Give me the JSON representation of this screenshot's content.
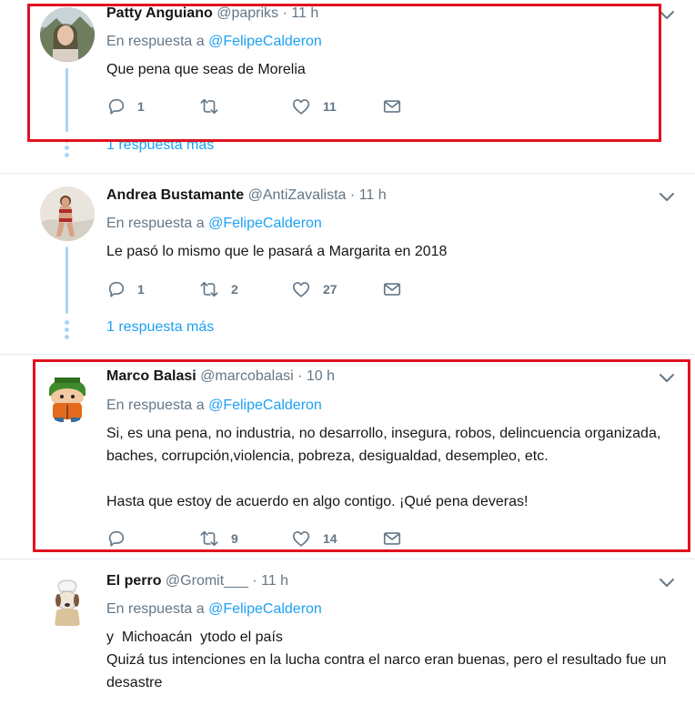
{
  "tweets": [
    {
      "name": "Patty Anguiano",
      "handle": "@papriks",
      "sep": "·",
      "time": "11 h",
      "reply_prefix": "En respuesta a",
      "reply_to": "@FelipeCalderon",
      "text": "Que pena que seas de Morelia",
      "replies": "1",
      "retweets": "",
      "likes": "11",
      "more_replies": "1 respuesta más"
    },
    {
      "name": "Andrea Bustamante",
      "handle": "@AntiZavalista",
      "sep": "·",
      "time": "11 h",
      "reply_prefix": "En respuesta a",
      "reply_to": "@FelipeCalderon",
      "text": "Le pasó lo mismo que le pasará a Margarita en 2018",
      "replies": "1",
      "retweets": "2",
      "likes": "27",
      "more_replies": "1 respuesta más"
    },
    {
      "name": "Marco Balasi",
      "handle": "@marcobalasi",
      "sep": "·",
      "time": "10 h",
      "reply_prefix": "En respuesta a",
      "reply_to": "@FelipeCalderon",
      "text_p1": "Si, es una pena, no industria, no desarrollo, insegura, robos, delincuencia organizada, baches, corrupción,violencia, pobreza, desigualdad, desempleo, etc.",
      "text_p2": "Hasta que estoy de acuerdo en algo contigo. ¡Qué pena deveras!",
      "replies": "",
      "retweets": "9",
      "likes": "14"
    },
    {
      "name": "El perro",
      "handle": "@Gromit___",
      "sep": "·",
      "time": "11 h",
      "reply_prefix": "En respuesta a",
      "reply_to": "@FelipeCalderon",
      "text_l1": "y  Michoacán  ytodo el país",
      "text_l2": "Quizá tus intenciones en la lucha contra el narco eran buenas, pero el resultado fue un desastre"
    }
  ],
  "icons": {
    "reply": "reply-icon",
    "retweet": "retweet-icon",
    "like": "heart-icon",
    "dm": "envelope-icon",
    "menu": "chevron-down-icon"
  },
  "colors": {
    "link": "#1da1f2",
    "muted": "#657786",
    "thread": "#abd4f2",
    "highlight": "#e0121f"
  }
}
